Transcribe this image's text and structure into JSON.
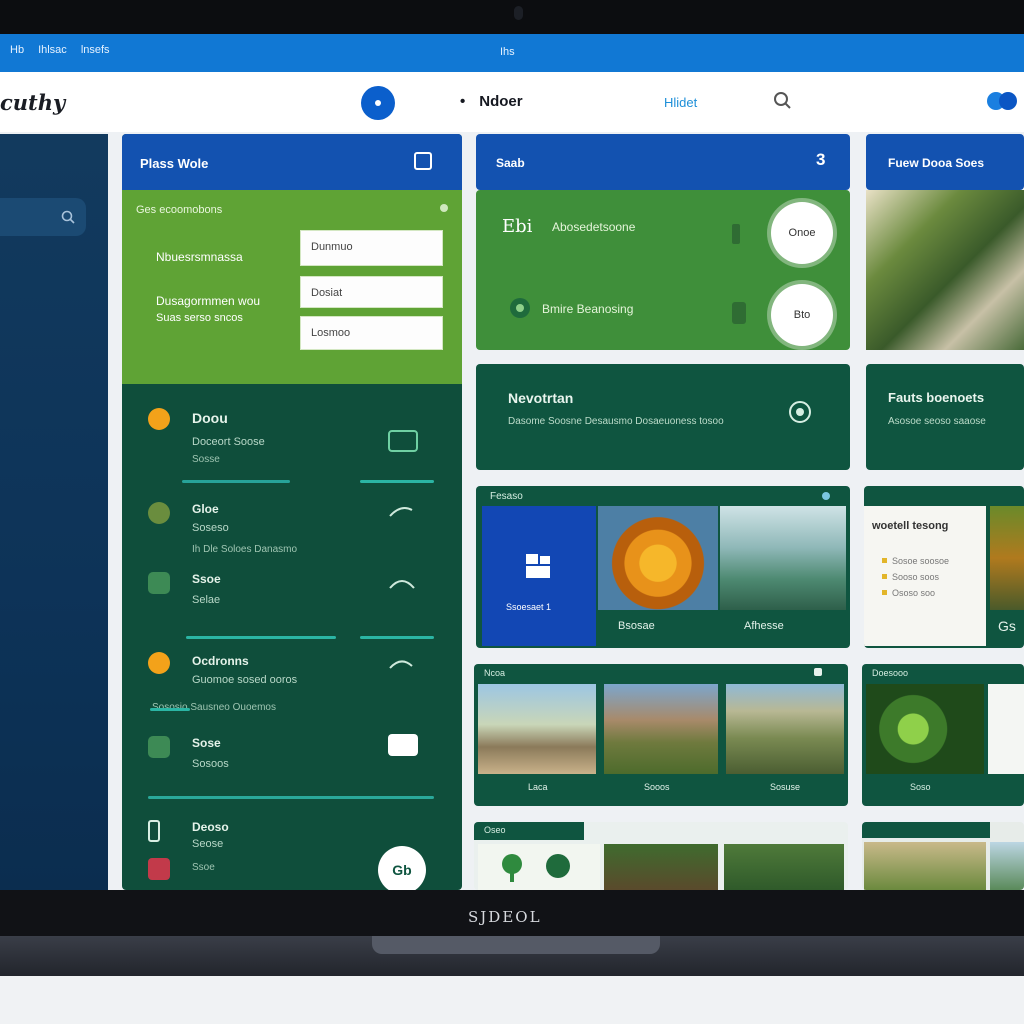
{
  "browser": {
    "links": [
      "Hb",
      "Ihlsac",
      "lnsefs"
    ],
    "center_text": "Ihs"
  },
  "appbar": {
    "logo": "cuthy",
    "nav_title": "Ndoer",
    "nav_bullet": "•",
    "nav_link": "Hlidet",
    "icons": {
      "nav_circle": "circle-icon",
      "search": "search-icon",
      "toggle": "toggle-icon"
    }
  },
  "sidebar": {
    "search_icon": "search-icon"
  },
  "panel_left": {
    "title": "Plass Wole",
    "form_caption": "Ges ecoomobons",
    "label_1": "Nbuesrsmnassa",
    "label_2a": "Dusagormmen wou",
    "label_2b": "Suas serso sncos",
    "field_1": "Dunmuo",
    "field_2": "Dosiat",
    "field_3": "Losmoo",
    "items": [
      {
        "title": "Doou",
        "sub": "Doceort Soose",
        "sub2": "Sosse"
      },
      {
        "title": "Gloe",
        "sub": "Soseso",
        "sub2": "Ih Dle Soloes Danasmo"
      },
      {
        "title": "Ssoe",
        "sub": "Selae",
        "sub2": ""
      },
      {
        "title": "Ocdronns",
        "sub": "Guomoe sosed ooros",
        "sub2": "Sososio Sausneo Ouoemos"
      },
      {
        "title": "Sose",
        "sub": "Sosoos",
        "sub2": ""
      },
      {
        "title": "Deoso",
        "sub": "Seose",
        "sub2": "Ssoe"
      }
    ],
    "fab_label": "Gb"
  },
  "panel_mid": {
    "title": "Saab",
    "badge": "3",
    "row_1_title": "Ebi",
    "row_1_text": "Abosedetsoone",
    "row_1_btn": "Onoe",
    "row_2_text": "Bmire Beanosing",
    "row_2_btn": "Bto",
    "card_title": "Nevotrtan",
    "card_text": "Dasome Soosne Desausmo Dosaeuoness tosoo",
    "gallery_title": "Fesaso",
    "gallery_tile": "Ssoesaet 1",
    "gallery_cap_1": "Bsosae",
    "gallery_cap_2": "Afhesse",
    "strip_title": "Ncoa",
    "strip_caps": [
      "Laca",
      "Sooos",
      "Sosuse"
    ],
    "bottom_title": "Oseo"
  },
  "panel_right": {
    "title": "Fuew Dooa Soes",
    "card_title": "Fauts boenoets",
    "card_text": "Asosoe seoso saaose",
    "doc_title": "woetell tesong",
    "doc_lines": [
      "Sosoe soosoe",
      "Sooso soos",
      "Ososo soo"
    ],
    "doc_cap": "Gs",
    "strip_title": "Doesooo",
    "strip_cap": "Soso"
  },
  "device": {
    "brand": "SJDEOL"
  }
}
